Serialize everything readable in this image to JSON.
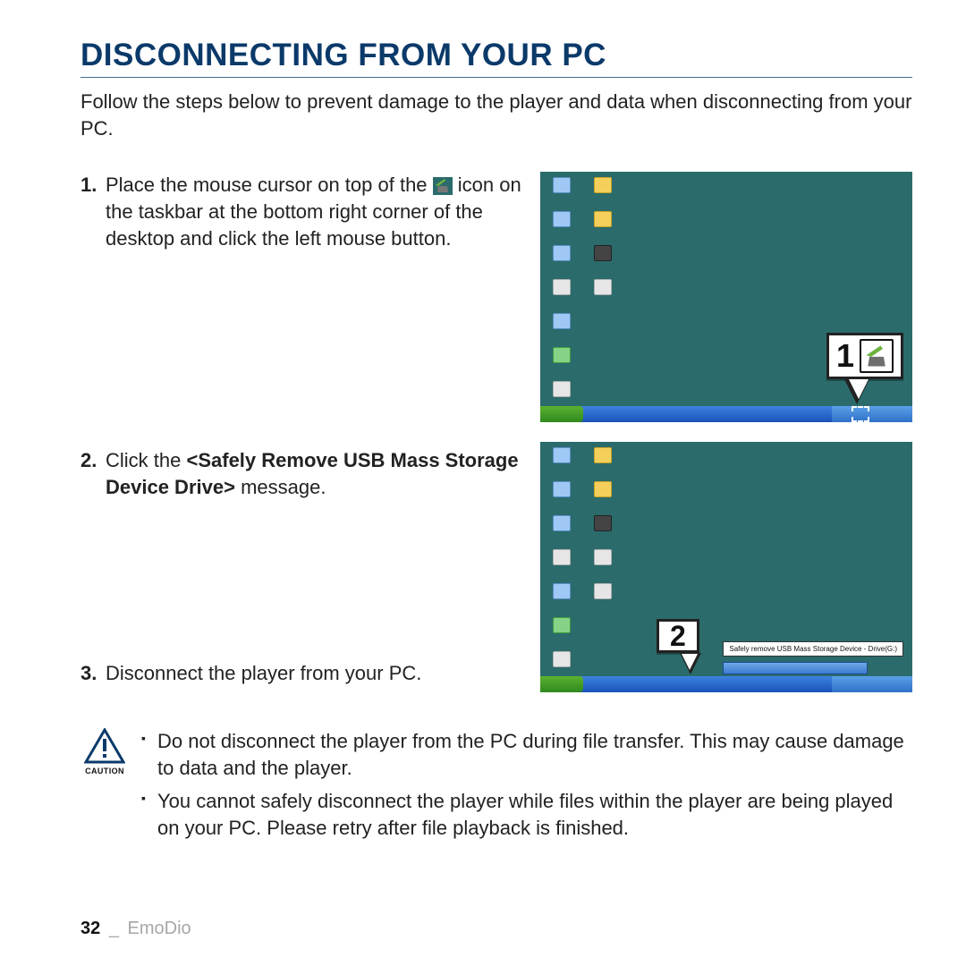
{
  "title": "DISCONNECTING FROM YOUR PC",
  "intro": "Follow the steps below to prevent damage to the player and data when disconnecting from your PC.",
  "steps": {
    "s1": {
      "num": "1.",
      "pre": "Place the mouse cursor on top of the ",
      "post": " icon on the taskbar at the bottom right corner of the desktop and click the left mouse button."
    },
    "s2": {
      "num": "2.",
      "pre": "Click the ",
      "bold": "<Safely Remove USB Mass Storage Device Drive>",
      "post": " message."
    },
    "s3": {
      "num": "3.",
      "text": "Disconnect the player from your PC."
    }
  },
  "callouts": {
    "c1": "1",
    "c2": "2",
    "tooltip": "Safely remove USB Mass Storage Device - Drive(G:)"
  },
  "caution": {
    "label": "CAUTION",
    "items": [
      "Do not disconnect the player from the PC during file transfer. This may cause damage to data and the player.",
      "You cannot safely disconnect the player while files within the player are being played on your PC. Please retry after file playback is finished."
    ]
  },
  "footer": {
    "page": "32",
    "sep": "_",
    "section": "EmoDio"
  }
}
